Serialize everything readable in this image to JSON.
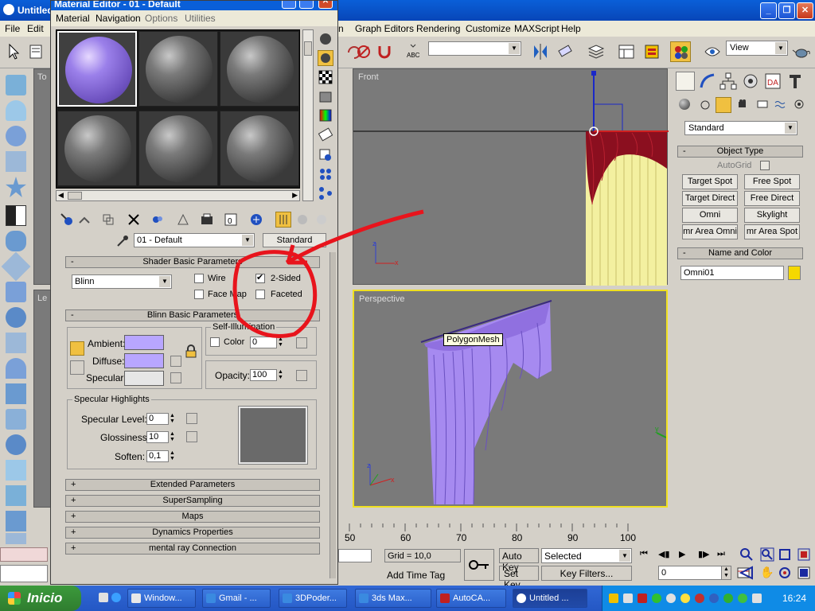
{
  "app": {
    "title": "Untitled",
    "taskbar_title": "Untitled ..."
  },
  "menubar": {
    "items": [
      "File",
      "Edit",
      "n",
      "Graph Editors",
      "Rendering",
      "Customize",
      "MAXScript",
      "Help"
    ]
  },
  "toolbar": {
    "view_dropdown": "View"
  },
  "viewports": {
    "front_label": "Front",
    "perspective_label": "Perspective",
    "left_label_fragment": "Le",
    "top_label_fragment": "To",
    "tooltip": "PolygonMesh"
  },
  "command_panel": {
    "category_dropdown": "Standard",
    "object_type_header": "Object Type",
    "autogrid_label": "AutoGrid",
    "buttons": [
      "Target Spot",
      "Free Spot",
      "Target Direct",
      "Free Direct",
      "Omni",
      "Skylight",
      "mr Area Omni",
      "mr Area Spot"
    ],
    "name_color_header": "Name and Color",
    "object_name": "Omni01",
    "object_color": "#f5d800"
  },
  "material_editor": {
    "title": "Material Editor - 01 - Default",
    "menu": [
      "Material",
      "Navigation",
      "Options",
      "Utilities"
    ],
    "material_name": "01 - Default",
    "material_type": "Standard",
    "shader_header": "Shader Basic Parameters",
    "shader_type": "Blinn",
    "wire_label": "Wire",
    "two_sided_label": "2-Sided",
    "two_sided_checked": true,
    "face_map_label": "Face Map",
    "faceted_label": "Faceted",
    "blinn_header": "Blinn Basic Parameters",
    "self_illum_label": "Self-Illumination",
    "color_label": "Color",
    "color_value": "0",
    "ambient_label": "Ambient:",
    "diffuse_label": "Diffuse:",
    "specular_label": "Specular:",
    "ambient_color": "#b8a6ff",
    "diffuse_color": "#b8a6ff",
    "specular_color": "#e6e6e6",
    "opacity_label": "Opacity:",
    "opacity_value": "100",
    "spec_highlights_label": "Specular Highlights",
    "spec_level_label": "Specular Level:",
    "spec_level_value": "0",
    "glossiness_label": "Glossiness:",
    "glossiness_value": "10",
    "soften_label": "Soften:",
    "soften_value": "0,1",
    "rollouts": [
      "Extended Parameters",
      "SuperSampling",
      "Maps",
      "Dynamics Properties",
      "mental ray Connection"
    ]
  },
  "timeline": {
    "ticks": [
      "50",
      "60",
      "70",
      "80",
      "90",
      "100"
    ]
  },
  "status": {
    "grid": "Grid = 10,0",
    "add_time_tag": "Add Time Tag",
    "auto_key": "Auto Key",
    "set_key": "Set Key",
    "selected": "Selected",
    "key_filters": "Key Filters...",
    "frame": "0"
  },
  "taskbar": {
    "start": "Inicio",
    "tasks": [
      "Window...",
      "Gmail - ...",
      "3DPoder...",
      "3ds Max...",
      "AutoCA...",
      "Untitled ..."
    ],
    "clock": "16:24"
  }
}
